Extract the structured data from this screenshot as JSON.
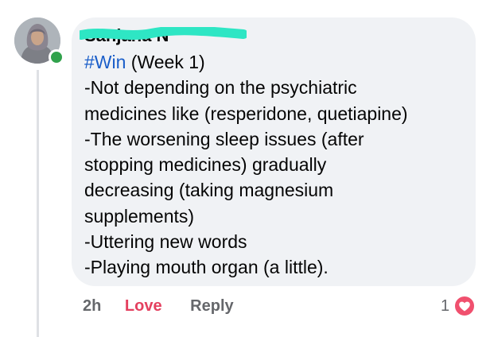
{
  "comment": {
    "author_name": "Sanjana N",
    "body": {
      "hashtag": "#Win",
      "first_line_rest": " (Week 1)",
      "lines": [
        "-Not depending on the psychiatric",
        "medicines like (resperidone, quetiapine)",
        "-The worsening sleep issues (after",
        "stopping medicines) gradually",
        "decreasing (taking magnesium",
        "supplements)",
        "-Uttering new words",
        "-Playing mouth organ (a little)."
      ]
    },
    "timestamp": "2h",
    "love_label": "Love",
    "reply_label": "Reply",
    "reaction_count": "1",
    "reaction_icon": "heart-icon"
  },
  "colors": {
    "bubble_bg": "#f0f2f5",
    "hashtag": "#1a5ec9",
    "love": "#e4405f",
    "online": "#31a24c",
    "redaction": "#2ee6c4",
    "meta_text": "#65676b"
  }
}
